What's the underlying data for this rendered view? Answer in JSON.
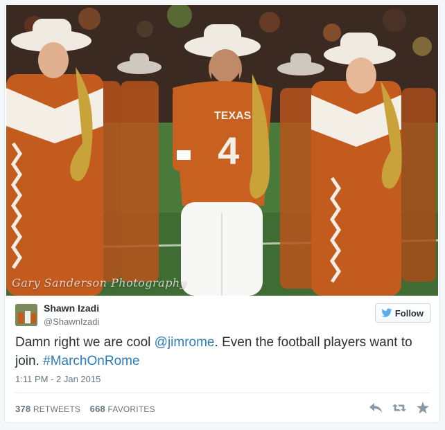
{
  "photo": {
    "watermark": "Gary Sanderson Photography",
    "jersey_text": "TEXAS",
    "jersey_number": "4",
    "colors": {
      "burnt_orange": "#c35a1e",
      "field_green": "#4c7a3c",
      "hat_white": "#efeae2",
      "sax_gold": "#c9a23a"
    }
  },
  "tweet": {
    "author_name": "Shawn Izadi",
    "author_handle": "@ShawnIzadi",
    "follow_label": "Follow",
    "text_part1": "Damn right we are cool ",
    "mention": "@jimrome",
    "text_part2": ". Even the football players want to join. ",
    "hashtag": "#MarchOnRome",
    "timestamp": "1:11 PM - 2 Jan 2015",
    "retweets_count": "378",
    "retweets_label": "RETWEETS",
    "favorites_count": "668",
    "favorites_label": "FAVORITES",
    "icons": [
      "twitter-bird-icon",
      "reply-icon",
      "retweet-icon",
      "favorite-star-icon"
    ],
    "colors": {
      "link": "#2b7bb9",
      "text": "#292f33",
      "muted": "#66757f",
      "twitter_blue": "#55acee"
    }
  }
}
